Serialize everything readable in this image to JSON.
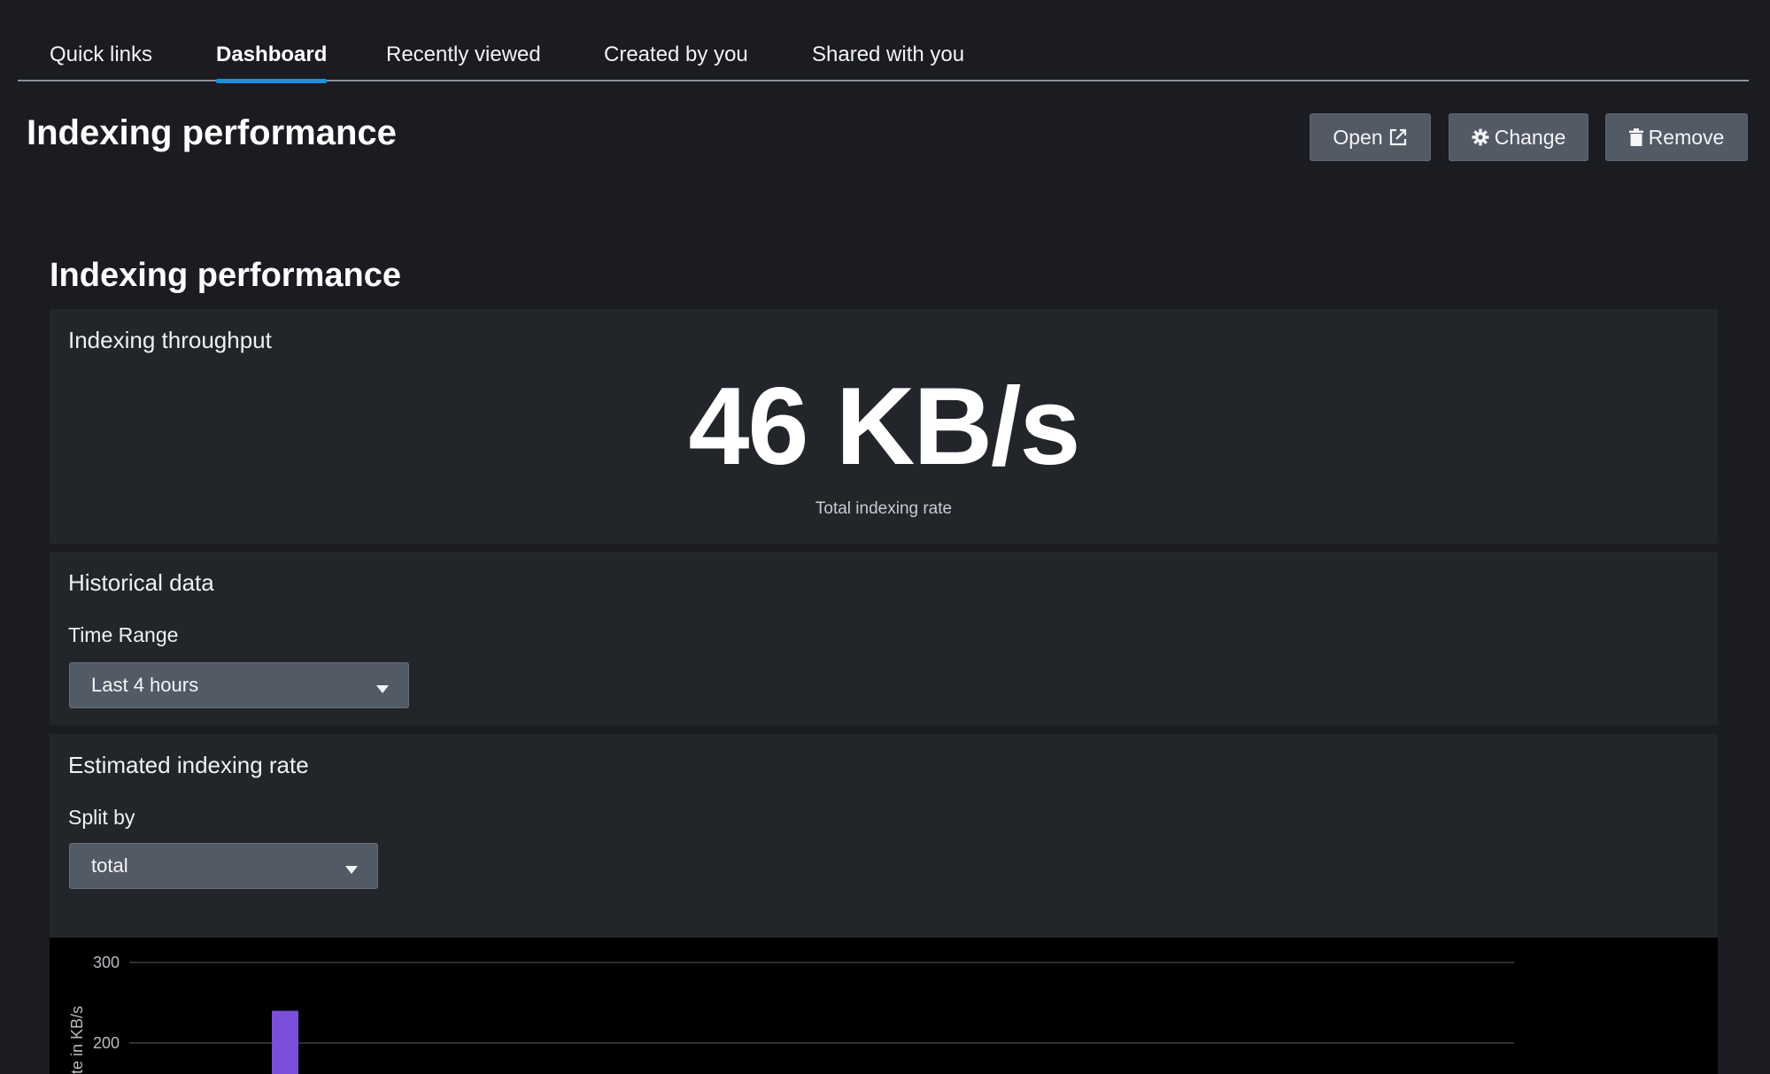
{
  "tabs": [
    {
      "label": "Quick links",
      "active": false
    },
    {
      "label": "Dashboard",
      "active": true
    },
    {
      "label": "Recently viewed",
      "active": false
    },
    {
      "label": "Created by you",
      "active": false
    },
    {
      "label": "Shared with you",
      "active": false
    }
  ],
  "header": {
    "title": "Indexing performance",
    "buttons": {
      "open": {
        "label": "Open",
        "icon": "external-link-icon"
      },
      "change": {
        "label": "Change",
        "icon": "gear-icon"
      },
      "remove": {
        "label": "Remove",
        "icon": "trash-icon"
      }
    }
  },
  "section": {
    "title": "Indexing performance"
  },
  "throughput": {
    "heading": "Indexing throughput",
    "value": "46 KB/s",
    "caption": "Total indexing rate"
  },
  "historical": {
    "heading": "Historical data",
    "time_range_label": "Time Range",
    "time_range_value": "Last 4 hours"
  },
  "estimated": {
    "heading": "Estimated indexing rate",
    "split_label": "Split by",
    "split_value": "total"
  },
  "colors": {
    "accent": "#1c8fe0",
    "bar": "#7b4fd9",
    "button": "#525a66"
  },
  "chart_data": {
    "type": "bar",
    "ylabel": "te in KB/s",
    "y_ticks": [
      300,
      200
    ],
    "ylim": [
      0,
      300
    ],
    "values": [
      240
    ],
    "grid": true
  }
}
